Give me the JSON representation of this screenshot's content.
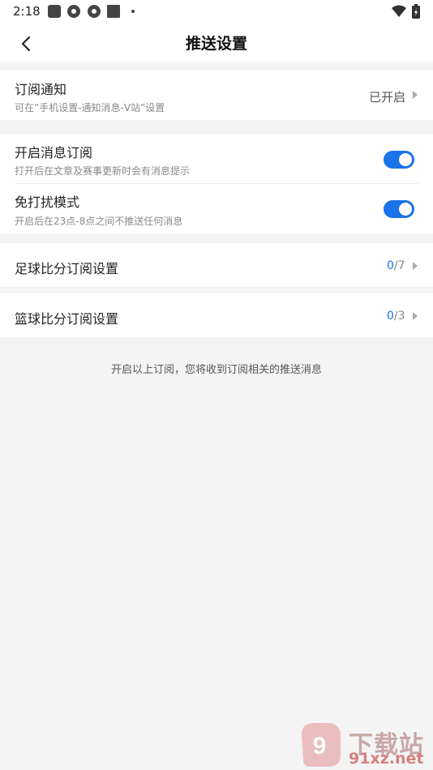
{
  "status_bar": {
    "time": "2:18"
  },
  "header": {
    "title": "推送设置"
  },
  "subscription": {
    "title": "订阅通知",
    "subtitle": "可在“手机设置-通知消息-V站”设置",
    "status": "已开启"
  },
  "message_sub": {
    "title": "开启消息订阅",
    "subtitle": "打开后在文章及赛事更新时会有消息提示",
    "enabled": true
  },
  "dnd": {
    "title": "免打扰模式",
    "subtitle": "开启后在23点-8点之间不推送任何消息",
    "enabled": true
  },
  "football": {
    "title": "足球比分订阅设置",
    "count": "0",
    "total": "/7"
  },
  "basketball": {
    "title": "篮球比分订阅设置",
    "count": "0",
    "total": "/3"
  },
  "footer_note": "开启以上订阅，您将收到订阅相关的推送消息",
  "watermark": {
    "text": "下载站",
    "url": "91xz.net"
  },
  "colors": {
    "accent": "#1a73e8",
    "background": "#f4f4f5"
  }
}
